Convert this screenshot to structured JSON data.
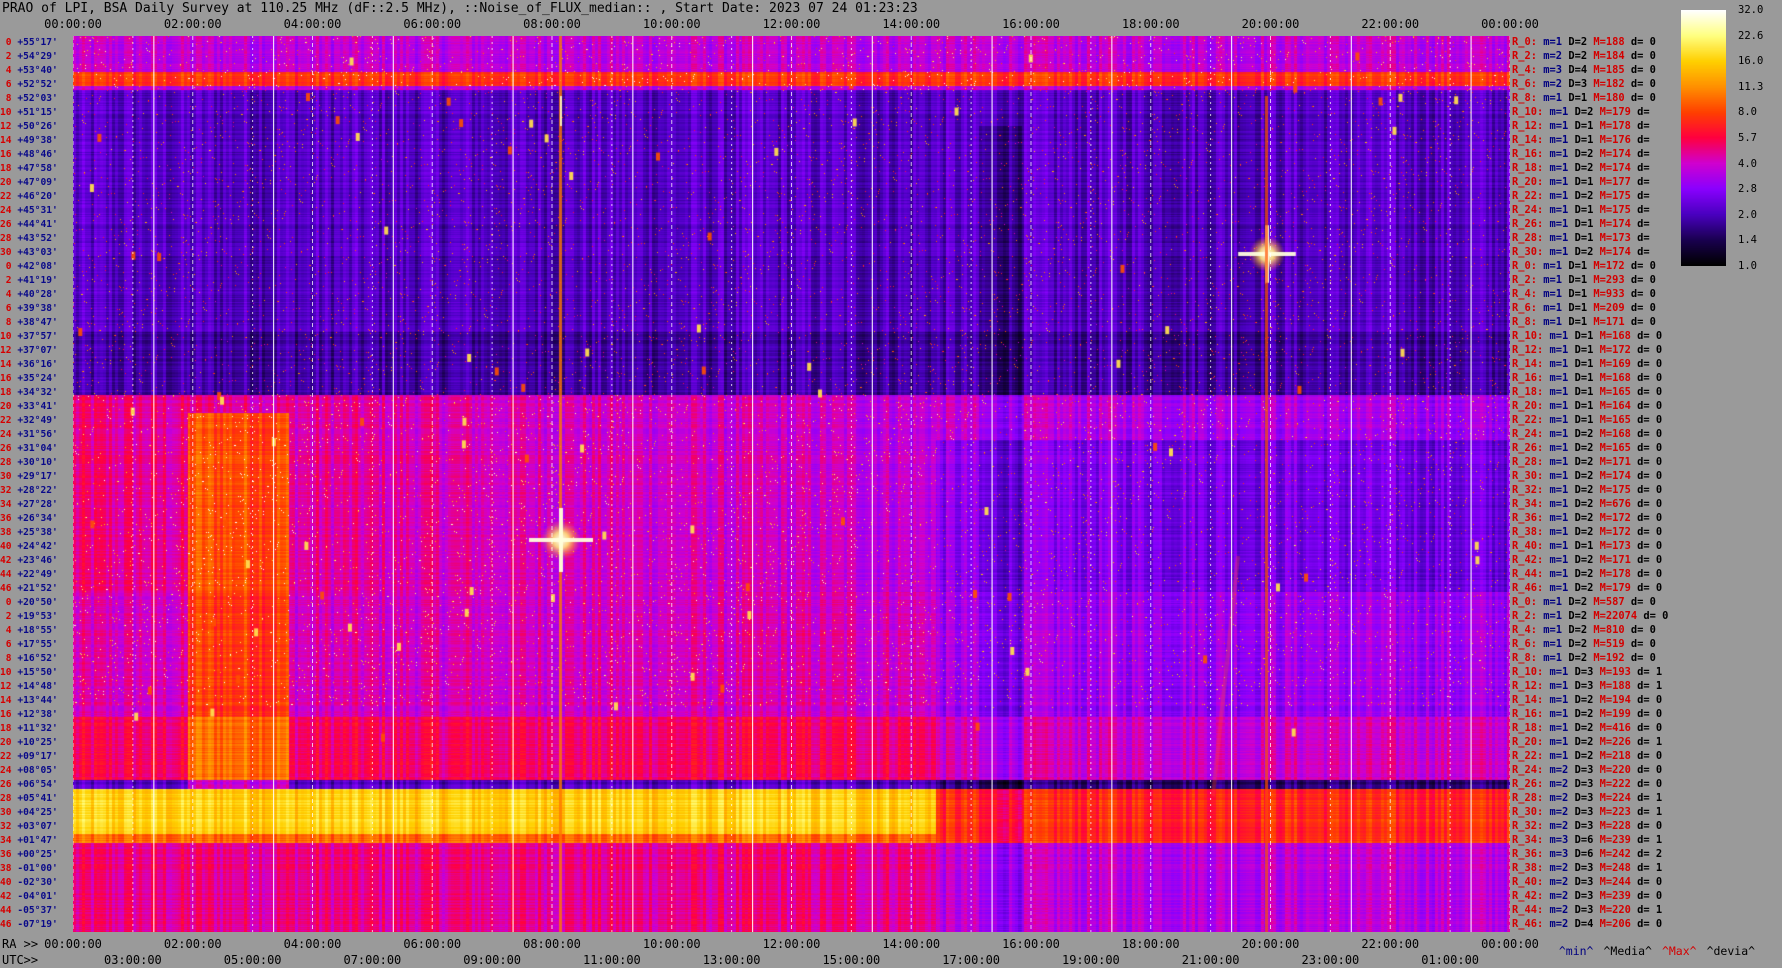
{
  "title": "PRAO of LPI, BSA Daily Survey at 110.25 MHz (dF::2.5 MHz), ::Noise_of_FLUX_median:: , Start Date: 2023 07 24 01:23:23",
  "top_times": [
    "00:00:00",
    "02:00:00",
    "04:00:00",
    "06:00:00",
    "08:00:00",
    "10:00:00",
    "12:00:00",
    "14:00:00",
    "16:00:00",
    "18:00:00",
    "20:00:00",
    "22:00:00",
    "00:00:00"
  ],
  "ra_prefix": "RA >>",
  "ra_times": [
    "00:00:00",
    "02:00:00",
    "04:00:00",
    "06:00:00",
    "08:00:00",
    "10:00:00",
    "12:00:00",
    "14:00:00",
    "16:00:00",
    "18:00:00",
    "20:00:00",
    "22:00:00",
    "00:00:00"
  ],
  "utc_prefix": "UTC>>",
  "utc_times": [
    "03:00:00",
    "05:00:00",
    "07:00:00",
    "09:00:00",
    "11:00:00",
    "13:00:00",
    "15:00:00",
    "17:00:00",
    "19:00:00",
    "21:00:00",
    "23:00:00",
    "01:00:00"
  ],
  "colorbar": {
    "ticks": [
      "32.0",
      "22.6",
      "16.0",
      "11.3",
      "8.0",
      "5.7",
      "4.0",
      "2.8",
      "2.0",
      "1.4",
      "1.0"
    ],
    "colors": [
      "#000000",
      "#1a0050",
      "#4a00c0",
      "#8a00ff",
      "#d000d0",
      "#ff0040",
      "#ff4000",
      "#ff9000",
      "#ffd000",
      "#ffff80",
      "#ffffff"
    ]
  },
  "declination_rows": [
    {
      "beam": "0",
      "dec": "+55°17'"
    },
    {
      "beam": "2",
      "dec": "+54°29'"
    },
    {
      "beam": "4",
      "dec": "+53°40'"
    },
    {
      "beam": "6",
      "dec": "+52°52'"
    },
    {
      "beam": "8",
      "dec": "+52°03'"
    },
    {
      "beam": "10",
      "dec": "+51°15'"
    },
    {
      "beam": "12",
      "dec": "+50°26'"
    },
    {
      "beam": "14",
      "dec": "+49°38'"
    },
    {
      "beam": "16",
      "dec": "+48°46'"
    },
    {
      "beam": "18",
      "dec": "+47°58'"
    },
    {
      "beam": "20",
      "dec": "+47°09'"
    },
    {
      "beam": "22",
      "dec": "+46°20'"
    },
    {
      "beam": "24",
      "dec": "+45°31'"
    },
    {
      "beam": "26",
      "dec": "+44°41'"
    },
    {
      "beam": "28",
      "dec": "+43°52'"
    },
    {
      "beam": "30",
      "dec": "+43°03'"
    },
    {
      "beam": "0",
      "dec": "+42°08'"
    },
    {
      "beam": "2",
      "dec": "+41°19'"
    },
    {
      "beam": "4",
      "dec": "+40°28'"
    },
    {
      "beam": "6",
      "dec": "+39°38'"
    },
    {
      "beam": "8",
      "dec": "+38°47'"
    },
    {
      "beam": "10",
      "dec": "+37°57'"
    },
    {
      "beam": "12",
      "dec": "+37°07'"
    },
    {
      "beam": "14",
      "dec": "+36°16'"
    },
    {
      "beam": "16",
      "dec": "+35°24'"
    },
    {
      "beam": "18",
      "dec": "+34°32'"
    },
    {
      "beam": "20",
      "dec": "+33°41'"
    },
    {
      "beam": "22",
      "dec": "+32°49'"
    },
    {
      "beam": "24",
      "dec": "+31°56'"
    },
    {
      "beam": "26",
      "dec": "+31°04'"
    },
    {
      "beam": "28",
      "dec": "+30°10'"
    },
    {
      "beam": "30",
      "dec": "+29°17'"
    },
    {
      "beam": "32",
      "dec": "+28°22'"
    },
    {
      "beam": "34",
      "dec": "+27°28'"
    },
    {
      "beam": "36",
      "dec": "+26°34'"
    },
    {
      "beam": "38",
      "dec": "+25°38'"
    },
    {
      "beam": "40",
      "dec": "+24°42'"
    },
    {
      "beam": "42",
      "dec": "+23°46'"
    },
    {
      "beam": "44",
      "dec": "+22°49'"
    },
    {
      "beam": "46",
      "dec": "+21°52'"
    },
    {
      "beam": "0",
      "dec": "+20°50'"
    },
    {
      "beam": "2",
      "dec": "+19°53'"
    },
    {
      "beam": "4",
      "dec": "+18°55'"
    },
    {
      "beam": "6",
      "dec": "+17°55'"
    },
    {
      "beam": "8",
      "dec": "+16°52'"
    },
    {
      "beam": "10",
      "dec": "+15°50'"
    },
    {
      "beam": "12",
      "dec": "+14°48'"
    },
    {
      "beam": "14",
      "dec": "+13°44'"
    },
    {
      "beam": "16",
      "dec": "+12°38'"
    },
    {
      "beam": "18",
      "dec": "+11°32'"
    },
    {
      "beam": "20",
      "dec": "+10°25'"
    },
    {
      "beam": "22",
      "dec": "+09°17'"
    },
    {
      "beam": "24",
      "dec": "+08°05'"
    },
    {
      "beam": "26",
      "dec": "+06°54'"
    },
    {
      "beam": "28",
      "dec": "+05°41'"
    },
    {
      "beam": "30",
      "dec": "+04°25'"
    },
    {
      "beam": "32",
      "dec": "+03°07'"
    },
    {
      "beam": "34",
      "dec": "+01°47'"
    },
    {
      "beam": "36",
      "dec": "+00°25'"
    },
    {
      "beam": "38",
      "dec": "-01°00'"
    },
    {
      "beam": "40",
      "dec": "-02°30'"
    },
    {
      "beam": "42",
      "dec": "-04°01'"
    },
    {
      "beam": "44",
      "dec": "-05°37'"
    },
    {
      "beam": "46",
      "dec": "-07°19'"
    }
  ],
  "stats": [
    {
      "r": "R_0:",
      "m": "m=1",
      "D": "D=2",
      "M": "M=188",
      "d": "d= 0"
    },
    {
      "r": "R_2:",
      "m": "m=2",
      "D": "D=2",
      "M": "M=184",
      "d": "d= 0"
    },
    {
      "r": "R_4:",
      "m": "m=3",
      "D": "D=4",
      "M": "M=185",
      "d": "d= 0"
    },
    {
      "r": "R_6:",
      "m": "m=2",
      "D": "D=3",
      "M": "M=182",
      "d": "d= 0"
    },
    {
      "r": "R_8:",
      "m": "m=1",
      "D": "D=1",
      "M": "M=180",
      "d": "d= 0"
    },
    {
      "r": "R_10:",
      "m": "m=1",
      "D": "D=2",
      "M": "M=179",
      "d": "d="
    },
    {
      "r": "R_12:",
      "m": "m=1",
      "D": "D=1",
      "M": "M=178",
      "d": "d="
    },
    {
      "r": "R_14:",
      "m": "m=1",
      "D": "D=1",
      "M": "M=176",
      "d": "d="
    },
    {
      "r": "R_16:",
      "m": "m=1",
      "D": "D=2",
      "M": "M=174",
      "d": "d="
    },
    {
      "r": "R_18:",
      "m": "m=1",
      "D": "D=2",
      "M": "M=174",
      "d": "d="
    },
    {
      "r": "R_20:",
      "m": "m=1",
      "D": "D=1",
      "M": "M=177",
      "d": "d="
    },
    {
      "r": "R_22:",
      "m": "m=1",
      "D": "D=2",
      "M": "M=175",
      "d": "d="
    },
    {
      "r": "R_24:",
      "m": "m=1",
      "D": "D=1",
      "M": "M=175",
      "d": "d="
    },
    {
      "r": "R_26:",
      "m": "m=1",
      "D": "D=1",
      "M": "M=174",
      "d": "d="
    },
    {
      "r": "R_28:",
      "m": "m=1",
      "D": "D=1",
      "M": "M=173",
      "d": "d="
    },
    {
      "r": "R_30:",
      "m": "m=1",
      "D": "D=2",
      "M": "M=174",
      "d": "d="
    },
    {
      "r": "R_0:",
      "m": "m=1",
      "D": "D=1",
      "M": "M=172",
      "d": "d= 0"
    },
    {
      "r": "R_2:",
      "m": "m=1",
      "D": "D=1",
      "M": "M=293",
      "d": "d= 0"
    },
    {
      "r": "R_4:",
      "m": "m=1",
      "D": "D=1",
      "M": "M=933",
      "d": "d= 0"
    },
    {
      "r": "R_6:",
      "m": "m=1",
      "D": "D=1",
      "M": "M=209",
      "d": "d= 0"
    },
    {
      "r": "R_8:",
      "m": "m=1",
      "D": "D=1",
      "M": "M=171",
      "d": "d= 0"
    },
    {
      "r": "R_10:",
      "m": "m=1",
      "D": "D=1",
      "M": "M=168",
      "d": "d= 0"
    },
    {
      "r": "R_12:",
      "m": "m=1",
      "D": "D=1",
      "M": "M=172",
      "d": "d= 0"
    },
    {
      "r": "R_14:",
      "m": "m=1",
      "D": "D=1",
      "M": "M=169",
      "d": "d= 0"
    },
    {
      "r": "R_16:",
      "m": "m=1",
      "D": "D=1",
      "M": "M=168",
      "d": "d= 0"
    },
    {
      "r": "R_18:",
      "m": "m=1",
      "D": "D=1",
      "M": "M=165",
      "d": "d= 0"
    },
    {
      "r": "R_20:",
      "m": "m=1",
      "D": "D=1",
      "M": "M=164",
      "d": "d= 0"
    },
    {
      "r": "R_22:",
      "m": "m=1",
      "D": "D=1",
      "M": "M=165",
      "d": "d= 0"
    },
    {
      "r": "R_24:",
      "m": "m=1",
      "D": "D=2",
      "M": "M=168",
      "d": "d= 0"
    },
    {
      "r": "R_26:",
      "m": "m=1",
      "D": "D=2",
      "M": "M=165",
      "d": "d= 0"
    },
    {
      "r": "R_28:",
      "m": "m=1",
      "D": "D=2",
      "M": "M=171",
      "d": "d= 0"
    },
    {
      "r": "R_30:",
      "m": "m=1",
      "D": "D=2",
      "M": "M=174",
      "d": "d= 0"
    },
    {
      "r": "R_32:",
      "m": "m=1",
      "D": "D=2",
      "M": "M=175",
      "d": "d= 0"
    },
    {
      "r": "R_34:",
      "m": "m=1",
      "D": "D=2",
      "M": "M=676",
      "d": "d= 0"
    },
    {
      "r": "R_36:",
      "m": "m=1",
      "D": "D=2",
      "M": "M=172",
      "d": "d= 0"
    },
    {
      "r": "R_38:",
      "m": "m=1",
      "D": "D=2",
      "M": "M=172",
      "d": "d= 0"
    },
    {
      "r": "R_40:",
      "m": "m=1",
      "D": "D=1",
      "M": "M=173",
      "d": "d= 0"
    },
    {
      "r": "R_42:",
      "m": "m=1",
      "D": "D=2",
      "M": "M=171",
      "d": "d= 0"
    },
    {
      "r": "R_44:",
      "m": "m=1",
      "D": "D=2",
      "M": "M=178",
      "d": "d= 0"
    },
    {
      "r": "R_46:",
      "m": "m=1",
      "D": "D=2",
      "M": "M=179",
      "d": "d= 0"
    },
    {
      "r": "R_0:",
      "m": "m=1",
      "D": "D=2",
      "M": "M=587",
      "d": "d= 0"
    },
    {
      "r": "R_2:",
      "m": "m=1",
      "D": "D=2",
      "M": "M=22074",
      "d": "d= 0"
    },
    {
      "r": "R_4:",
      "m": "m=1",
      "D": "D=2",
      "M": "M=810",
      "d": "d= 0"
    },
    {
      "r": "R_6:",
      "m": "m=1",
      "D": "D=2",
      "M": "M=519",
      "d": "d= 0"
    },
    {
      "r": "R_8:",
      "m": "m=1",
      "D": "D=2",
      "M": "M=192",
      "d": "d= 0"
    },
    {
      "r": "R_10:",
      "m": "m=1",
      "D": "D=3",
      "M": "M=193",
      "d": "d= 1"
    },
    {
      "r": "R_12:",
      "m": "m=1",
      "D": "D=3",
      "M": "M=188",
      "d": "d= 1"
    },
    {
      "r": "R_14:",
      "m": "m=1",
      "D": "D=2",
      "M": "M=194",
      "d": "d= 0"
    },
    {
      "r": "R_16:",
      "m": "m=1",
      "D": "D=2",
      "M": "M=199",
      "d": "d= 0"
    },
    {
      "r": "R_18:",
      "m": "m=1",
      "D": "D=2",
      "M": "M=416",
      "d": "d= 0"
    },
    {
      "r": "R_20:",
      "m": "m=1",
      "D": "D=2",
      "M": "M=226",
      "d": "d= 1"
    },
    {
      "r": "R_22:",
      "m": "m=1",
      "D": "D=2",
      "M": "M=218",
      "d": "d= 0"
    },
    {
      "r": "R_24:",
      "m": "m=2",
      "D": "D=3",
      "M": "M=220",
      "d": "d= 0"
    },
    {
      "r": "R_26:",
      "m": "m=2",
      "D": "D=3",
      "M": "M=222",
      "d": "d= 0"
    },
    {
      "r": "R_28:",
      "m": "m=2",
      "D": "D=3",
      "M": "M=224",
      "d": "d= 1"
    },
    {
      "r": "R_30:",
      "m": "m=2",
      "D": "D=3",
      "M": "M=223",
      "d": "d= 1"
    },
    {
      "r": "R_32:",
      "m": "m=2",
      "D": "D=3",
      "M": "M=228",
      "d": "d= 0"
    },
    {
      "r": "R_34:",
      "m": "m=3",
      "D": "D=6",
      "M": "M=239",
      "d": "d= 1"
    },
    {
      "r": "R_36:",
      "m": "m=3",
      "D": "D=6",
      "M": "M=242",
      "d": "d= 2"
    },
    {
      "r": "R_38:",
      "m": "m=2",
      "D": "D=3",
      "M": "M=248",
      "d": "d= 1"
    },
    {
      "r": "R_40:",
      "m": "m=2",
      "D": "D=3",
      "M": "M=244",
      "d": "d= 0"
    },
    {
      "r": "R_42:",
      "m": "m=2",
      "D": "D=3",
      "M": "M=239",
      "d": "d= 0"
    },
    {
      "r": "R_44:",
      "m": "m=2",
      "D": "D=3",
      "M": "M=220",
      "d": "d= 1"
    },
    {
      "r": "R_46:",
      "m": "m=2",
      "D": "D=4",
      "M": "M=206",
      "d": "d= 0"
    }
  ],
  "legend": {
    "min": "^min^",
    "median": "^Media^",
    "max": "^Max^",
    "devia": "^devia^"
  },
  "colors": {
    "background": "#9a9a9a",
    "beam_label": "#d40000",
    "dec_label": "#0a0a8a",
    "max_label": "#d40000",
    "stat_label": "#000080"
  }
}
